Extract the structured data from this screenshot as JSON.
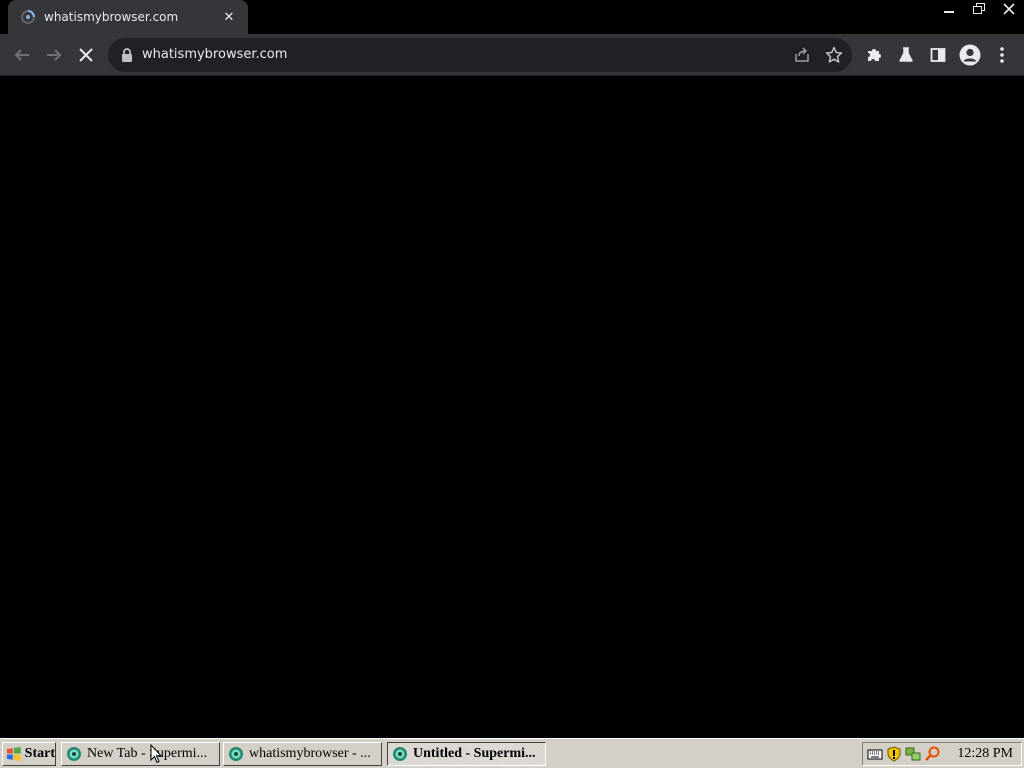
{
  "browser": {
    "tab": {
      "title": "whatismybrowser.com",
      "close_glyph": "✕"
    },
    "omnibox": {
      "url": "whatismybrowser.com"
    },
    "icons": {
      "favicon": "loading-spinner-icon",
      "back": "arrow-left-icon",
      "forward": "arrow-right-icon",
      "stop": "stop-x-icon",
      "lock": "lock-icon",
      "share": "share-icon",
      "bookmark": "star-icon",
      "extensions": "puzzle-icon",
      "labs": "flask-icon",
      "side_panel": "side-panel-icon",
      "profile": "avatar-icon",
      "menu": "kebab-menu-icon"
    },
    "colors": {
      "chrome": "#35363a",
      "omnibox": "#202124",
      "text": "#e8eaed",
      "page": "#000000"
    }
  },
  "taskbar": {
    "start_label": "Start",
    "tasks": [
      {
        "label": "New Tab - Supermi...",
        "active": false
      },
      {
        "label": "whatismybrowser - ...",
        "active": false
      },
      {
        "label": "Untitled - Supermi...",
        "active": true
      }
    ],
    "tray_icons": [
      "keyboard-icon",
      "shield-icon",
      "network-icon",
      "search-icon"
    ],
    "clock": "12:28 PM",
    "colors": {
      "face": "#d4d0c8"
    }
  }
}
